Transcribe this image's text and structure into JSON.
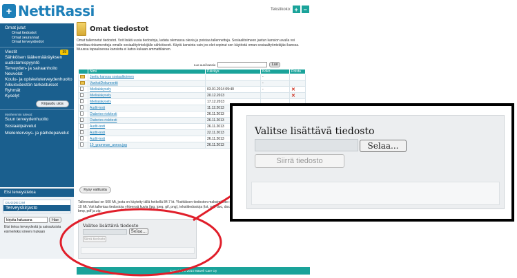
{
  "header": {
    "logo_mark": "+",
    "logo_text": "NettiRassi",
    "text_size_label": "Tekstikoko:",
    "plus": "+",
    "minus": "−"
  },
  "sidebar": {
    "omat_jutut": "Omat jutut",
    "sub": [
      "Omat tiedostot",
      "Omat seurannat",
      "Omat terveystiedot"
    ],
    "viestit": "Viestit",
    "viestit_count": "39",
    "items": [
      "Sähköisen lääkemääräyksen uudistamispyyntö",
      "Terveyden- ja sairaanhoito",
      "Neuvolat",
      "Koulu- ja opiskeluterveydenhuolto",
      "Aikuisväestön tarkastukset",
      "Ryhmät",
      "Kyselyt"
    ],
    "logout": "Kirjaudu ulos",
    "note": "Myöhemmin tulevat:",
    "later": [
      "Suun terveydenhuolto",
      "Sosiaalipalvelut",
      "Mielenterveys- ja päihdepalvelut"
    ]
  },
  "search": {
    "title": "Etsi terveystietoa",
    "duo_top": "DUODECIM",
    "duo_bottom": "Terveyskirjasto",
    "placeholder": "kirjoita hakusana",
    "button": "Hae",
    "desc": "Etsi tietoa terveydestä ja sairauksista esimerkiksi oireen mukaan"
  },
  "main": {
    "title": "Omat tiedostot",
    "intro": "Omat tallennetut tiedostot. Voit lisätä uusia tiedostoja, ladata olemassa olevia ja poistaa tallennettuja. Sosiaalitoimeen jaetun kansion avulla voi toimittaa dokumentteja omalle sosiaalityöntekijälle sähköisesti. Käytä kansiota vain jos olet sopinut sen käytöstä oman sosiaalityöntekijäsi kanssa. Muussa tapauksessa kansiota ei katso kukaan ammattilainen.",
    "search_label": "Luo uusi kansio",
    "search_button": "Luo",
    "columns": [
      "Nimi",
      "Päiväys",
      "Koko",
      "Poista"
    ],
    "rows": [
      {
        "name": "Jaettu kanssa sosiaalitoimen",
        "date": "",
        "size": "-",
        "del": ""
      },
      {
        "name": "VanhatDokumentit",
        "date": "",
        "size": "-",
        "del": ""
      },
      {
        "name": "Mielialakysely",
        "date": "03.01.2014 09:40",
        "size": "-",
        "del": "✕"
      },
      {
        "name": "Mielialakysely",
        "date": "20.12.2013",
        "size": "",
        "del": "✕"
      },
      {
        "name": "Mielialakysely",
        "date": "17.12.2013",
        "size": "",
        "del": ""
      },
      {
        "name": "Audit-testi",
        "date": "11.12.2013",
        "size": "",
        "del": ""
      },
      {
        "name": "Diabetes-riskitesti",
        "date": "26.11.2013",
        "size": "",
        "del": ""
      },
      {
        "name": "Diabetes-riskitesti",
        "date": "26.11.2013",
        "size": "",
        "del": ""
      },
      {
        "name": "Audit-testi",
        "date": "26.11.2013",
        "size": "",
        "del": ""
      },
      {
        "name": "Audit-testi",
        "date": "22.11.2013",
        "size": "",
        "del": ""
      },
      {
        "name": "Audit-testi",
        "date": "26.11.2013",
        "size": "",
        "del": ""
      },
      {
        "name": "10_gramman_annos.jpg",
        "date": "26.11.2013",
        "size": "",
        "del": ""
      }
    ],
    "ask_button": "Kysy valitusta",
    "storage_text": "Tallennustilasi on 500 Mt, josta on käytetty tällä hetkellä 84.7 kt. Yksittäisen tiedoston maksimikoko on 10 Mt. Voit tallentaa tiedostoja yhteensä kuvia (jpg, jpeg, gif, png), tekstitiedostoja (txt, pdf, doc, docx), bmp, pdf ja zip."
  },
  "upload": {
    "title": "Valitse lisättävä tiedosto",
    "browse": "Selaa...",
    "move": "Siirrä tiedosto"
  },
  "footer": "Copyright © 2014 Mawell Care Oy"
}
